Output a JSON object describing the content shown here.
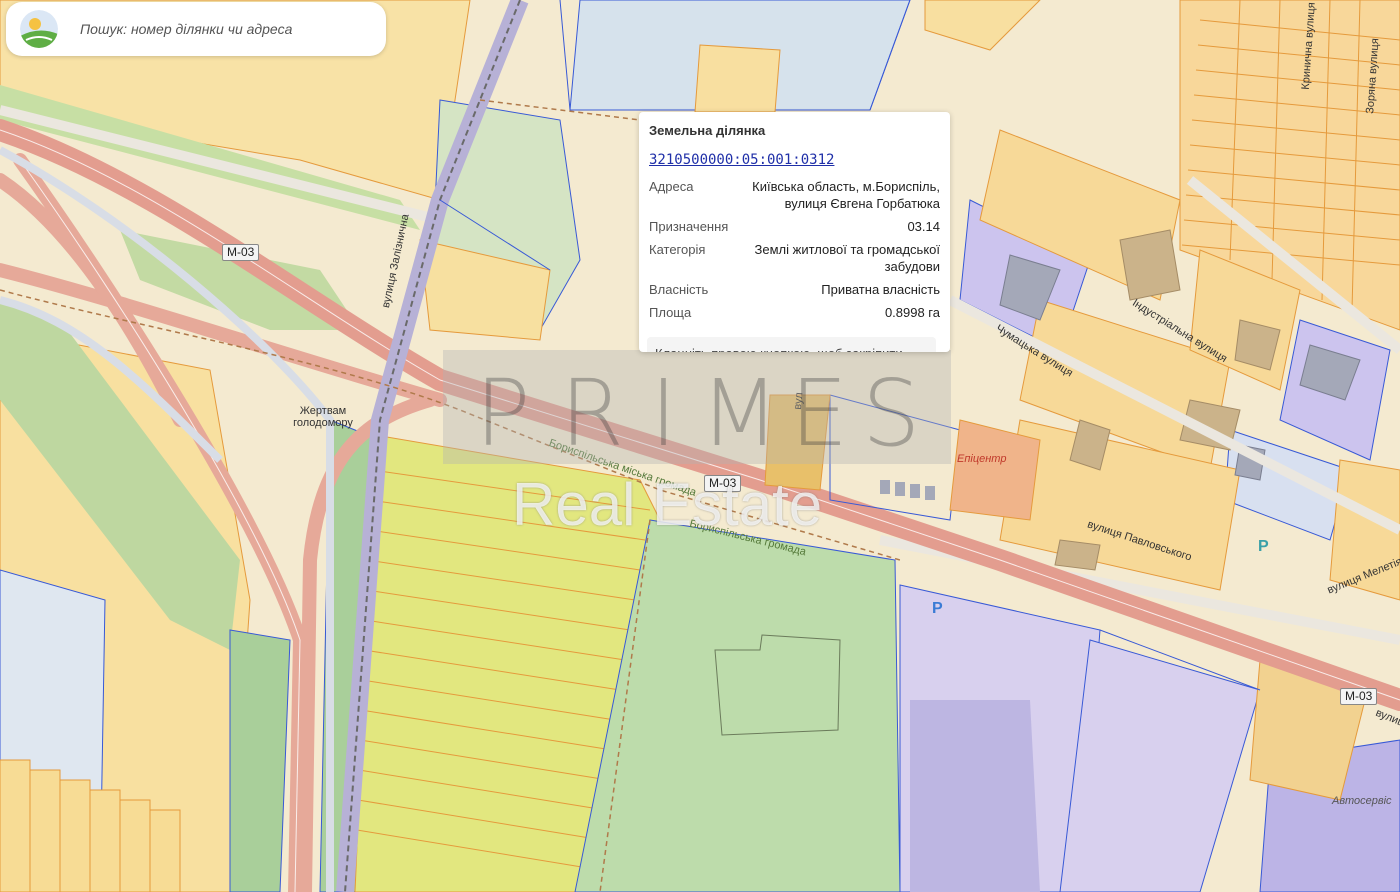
{
  "search": {
    "placeholder": "Пошук: номер ділянки чи адреса"
  },
  "popup": {
    "title": "Земельна ділянка",
    "cadastral_number": "3210500000:05:001:0312",
    "rows": [
      {
        "key": "Адреса",
        "value": "Київська область, м.Бориспіль, вулиця Євгена Горбатюка"
      },
      {
        "key": "Призначення",
        "value": "03.14"
      },
      {
        "key": "Категорія",
        "value": "Землі житлової та громадської забудови"
      },
      {
        "key": "Власність",
        "value": "Приватна власність"
      },
      {
        "key": "Площа",
        "value": "0.8998 га"
      }
    ],
    "hint": "Клацніть правою кнопкою, щоб закріпити попап"
  },
  "watermark": {
    "brand_letters": [
      "P",
      "R",
      "I",
      "M",
      "E",
      "S"
    ],
    "subtitle": "Real Estate"
  },
  "map": {
    "road_shields": [
      "М-03",
      "М-03",
      "М-03"
    ],
    "labels": {
      "memorial": "Жертвам голодомору",
      "street_chumatska": "Чумацька вулиця",
      "street_industrialna": "Індустріальна вулиця",
      "street_pavlovskoho": "вулиця Павловського",
      "street_meletiia": "вулиця Мелетія",
      "street_kryshtalna": "Кринична вулиця",
      "street_zorianа": "Зоряна вулиця",
      "street_zaliznychna": "вулиця Залізнична",
      "hromada_boryspil_north": "Бориспільська міська громада",
      "hromada_boryspil_south": "Бориспільська громада",
      "epicenter": "Епіцентр",
      "autoservice": "Автосервіс",
      "street_cut": "вулиц",
      "street_vert": "вул"
    },
    "parking_label": "P",
    "colors": {
      "residential": "#f8dca0",
      "agricultural": "#f2e9b8",
      "green": "#c7dfa4",
      "field": "#e0e57e",
      "industrial": "#cfc8ec",
      "road": "#e69b8b",
      "parcel_border": "#e59a3c",
      "boundary": "#3859d6",
      "link": "#1f2fa8"
    }
  }
}
